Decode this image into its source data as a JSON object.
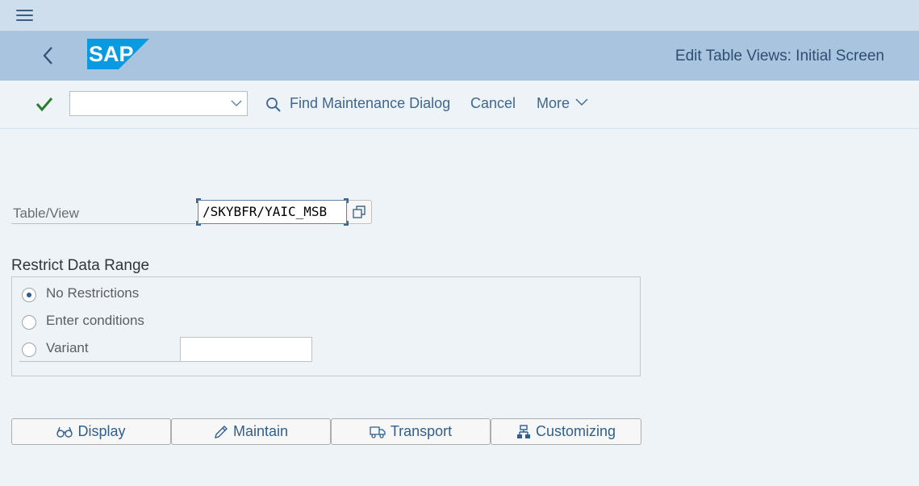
{
  "topbar": {
    "menu_icon": "hamburger-menu-icon"
  },
  "header": {
    "back_icon": "chevron-left-icon",
    "logo_text": "SAP",
    "title": "Edit Table Views: Initial Screen",
    "colors": {
      "logo_blue": "#0a9ae0",
      "header_bg": "#a9c4de",
      "title": "#2d4e72"
    }
  },
  "toolbar": {
    "confirm_icon": "checkmark-icon",
    "command_field": {
      "value": "",
      "placeholder": ""
    },
    "find_maintenance_dialog": "Find Maintenance Dialog",
    "cancel": "Cancel",
    "more": "More"
  },
  "form": {
    "table_view_label": "Table/View",
    "table_view_value": "/SKYBFR/YAIC_MSB",
    "restrict_title": "Restrict Data Range",
    "options": [
      {
        "label": "No Restrictions",
        "selected": true
      },
      {
        "label": "Enter conditions",
        "selected": false
      },
      {
        "label": "Variant",
        "selected": false
      }
    ],
    "variant_value": ""
  },
  "actions": {
    "display": "Display",
    "maintain": "Maintain",
    "transport": "Transport",
    "customizing": "Customizing"
  }
}
